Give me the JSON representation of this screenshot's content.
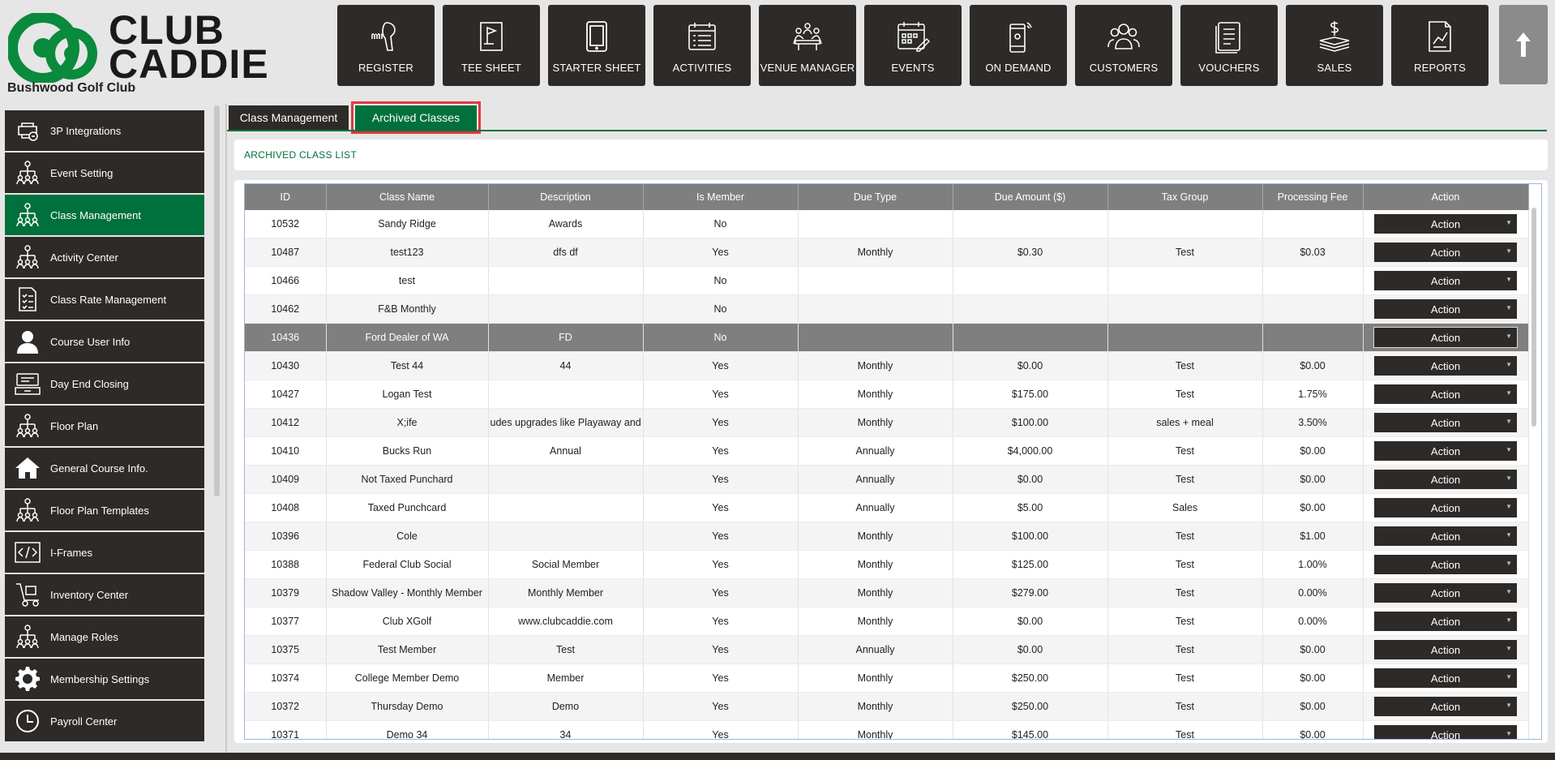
{
  "brand": {
    "line1": "CLUB",
    "line2": "CADDIE",
    "club_name": "Bushwood Golf Club",
    "green": "#00703c",
    "dark": "#2d2a28"
  },
  "nav": [
    {
      "label": "REGISTER",
      "icon": "barcode-scanner-icon"
    },
    {
      "label": "TEE SHEET",
      "icon": "golf-flag-icon"
    },
    {
      "label": "STARTER SHEET",
      "icon": "tablet-icon"
    },
    {
      "label": "ACTIVITIES",
      "icon": "calendar-list-icon"
    },
    {
      "label": "VENUE MANAGER",
      "icon": "meeting-table-icon"
    },
    {
      "label": "EVENTS",
      "icon": "calendar-pen-icon"
    },
    {
      "label": "ON DEMAND",
      "icon": "mobile-phone-icon"
    },
    {
      "label": "CUSTOMERS",
      "icon": "people-icon"
    },
    {
      "label": "VOUCHERS",
      "icon": "voucher-icon"
    },
    {
      "label": "SALES",
      "icon": "cash-stack-icon"
    },
    {
      "label": "REPORTS",
      "icon": "report-chart-icon"
    }
  ],
  "sidebar": {
    "items": [
      {
        "label": "3P Integrations",
        "icon": "integrations-icon",
        "active": false
      },
      {
        "label": "Event Setting",
        "icon": "org-chart-icon",
        "active": false
      },
      {
        "label": "Class Management",
        "icon": "org-chart-icon",
        "active": true
      },
      {
        "label": "Activity  Center",
        "icon": "org-chart-icon",
        "active": false
      },
      {
        "label": "Class Rate Management",
        "icon": "checklist-icon",
        "active": false
      },
      {
        "label": "Course User Info",
        "icon": "user-icon",
        "active": false
      },
      {
        "label": "Day End Closing",
        "icon": "register-drawer-icon",
        "active": false
      },
      {
        "label": "Floor Plan",
        "icon": "org-chart-icon",
        "active": false
      },
      {
        "label": "General Course Info.",
        "icon": "home-icon",
        "active": false
      },
      {
        "label": "Floor Plan Templates",
        "icon": "org-chart-icon",
        "active": false
      },
      {
        "label": "I-Frames",
        "icon": "code-icon",
        "active": false
      },
      {
        "label": "Inventory Center",
        "icon": "hand-truck-icon",
        "active": false
      },
      {
        "label": "Manage Roles",
        "icon": "org-chart-icon",
        "active": false
      },
      {
        "label": "Membership Settings",
        "icon": "gear-icon",
        "active": false
      },
      {
        "label": "Payroll Center",
        "icon": "clock-icon",
        "active": false
      }
    ]
  },
  "tabs": [
    {
      "label": "Class Management"
    },
    {
      "label": "Archived Classes"
    }
  ],
  "section_title": "ARCHIVED CLASS LIST",
  "table": {
    "columns": [
      "ID",
      "Class Name",
      "Description",
      "Is Member",
      "Due Type",
      "Due Amount ($)",
      "Tax Group",
      "Processing Fee",
      "Action"
    ],
    "action_label": "Action",
    "rows": [
      [
        "10532",
        "Sandy Ridge",
        "Awards",
        "No",
        "",
        "",
        "",
        ""
      ],
      [
        "10487",
        "test123",
        "dfs df",
        "Yes",
        "Monthly",
        "$0.30",
        "Test",
        "$0.03"
      ],
      [
        "10466",
        "test",
        "",
        "No",
        "",
        "",
        "",
        ""
      ],
      [
        "10462",
        "F&B Monthly",
        "",
        "No",
        "",
        "",
        "",
        ""
      ],
      [
        "10436",
        "Ford Dealer of WA",
        "FD",
        "No",
        "",
        "",
        "",
        ""
      ],
      [
        "10430",
        "Test 44",
        "44",
        "Yes",
        "Monthly",
        "$0.00",
        "Test",
        "$0.00"
      ],
      [
        "10427",
        "Logan Test",
        "",
        "Yes",
        "Monthly",
        "$175.00",
        "Test",
        "1.75%"
      ],
      [
        "10412",
        "X;ife",
        "udes upgrades like Playaway and ot",
        "Yes",
        "Monthly",
        "$100.00",
        "sales + meal",
        "3.50%"
      ],
      [
        "10410",
        "Bucks Run",
        "Annual",
        "Yes",
        "Annually",
        "$4,000.00",
        "Test",
        "$0.00"
      ],
      [
        "10409",
        "Not Taxed Punchard",
        "",
        "Yes",
        "Annually",
        "$0.00",
        "Test",
        "$0.00"
      ],
      [
        "10408",
        "Taxed Punchcard",
        "",
        "Yes",
        "Annually",
        "$5.00",
        "Sales",
        "$0.00"
      ],
      [
        "10396",
        "Cole",
        "",
        "Yes",
        "Monthly",
        "$100.00",
        "Test",
        "$1.00"
      ],
      [
        "10388",
        "Federal Club Social",
        "Social Member",
        "Yes",
        "Monthly",
        "$125.00",
        "Test",
        "1.00%"
      ],
      [
        "10379",
        "Shadow Valley - Monthly Member",
        "Monthly Member",
        "Yes",
        "Monthly",
        "$279.00",
        "Test",
        "0.00%"
      ],
      [
        "10377",
        "Club XGolf",
        "www.clubcaddie.com",
        "Yes",
        "Monthly",
        "$0.00",
        "Test",
        "0.00%"
      ],
      [
        "10375",
        "Test Member",
        "Test",
        "Yes",
        "Annually",
        "$0.00",
        "Test",
        "$0.00"
      ],
      [
        "10374",
        "College Member Demo",
        "Member",
        "Yes",
        "Monthly",
        "$250.00",
        "Test",
        "$0.00"
      ],
      [
        "10372",
        "Thursday Demo",
        "Demo",
        "Yes",
        "Monthly",
        "$250.00",
        "Test",
        "$0.00"
      ],
      [
        "10371",
        "Demo 34",
        "34",
        "Yes",
        "Monthly",
        "$145.00",
        "Test",
        "$0.00"
      ]
    ],
    "selected_row": 4
  }
}
